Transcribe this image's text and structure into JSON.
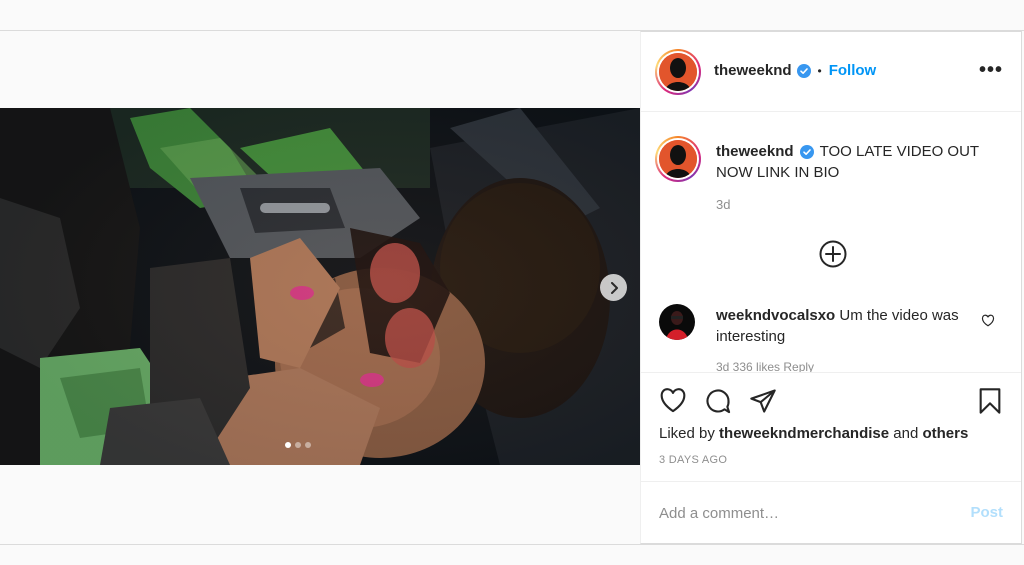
{
  "post": {
    "carousel": {
      "slide_count": 3,
      "active_index": 0,
      "next_icon": "chevron-right-icon"
    },
    "header": {
      "username": "theweeknd",
      "separator": "•",
      "follow_label": "Follow",
      "more_icon": "more-horizontal-icon",
      "more_label": "•••"
    },
    "caption": {
      "username": "theweeknd",
      "text": "TOO LATE VIDEO OUT NOW LINK IN BIO",
      "time": "3d"
    },
    "load_more_icon": "plus-circle-icon",
    "comments": [
      {
        "username": "weekndvocalsxo",
        "text": "Um the video was interesting",
        "meta": "3d   336 likes   Reply"
      }
    ],
    "actions": {
      "like_icon": "heart-icon",
      "comment_icon": "comment-icon",
      "share_icon": "paper-plane-icon",
      "save_icon": "bookmark-icon"
    },
    "likes": {
      "prefix": "Liked by",
      "user": "theweekndmerchandise",
      "conjunction": "and",
      "others": "others"
    },
    "posted_ago": "3 DAYS AGO",
    "add_comment": {
      "placeholder": "Add a comment…",
      "post_label": "Post"
    },
    "colors": {
      "accent": "#0095f6",
      "post_disabled": "#b2dffc",
      "secondary_text": "#8e8e8e",
      "verified": "#3897f0"
    }
  }
}
